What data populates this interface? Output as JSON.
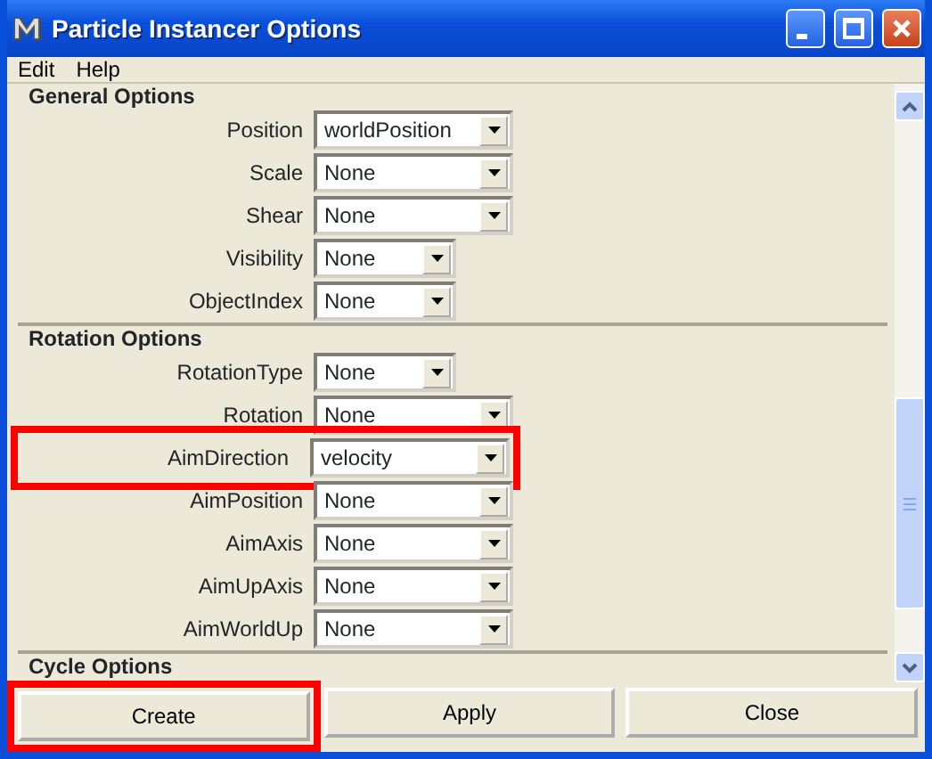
{
  "window": {
    "title": "Particle Instancer Options"
  },
  "menu": [
    "Edit",
    "Help"
  ],
  "sections": [
    {
      "title": "General Options",
      "fields": [
        {
          "label": "Position",
          "value": "worldPosition",
          "kind": "wide",
          "highlighted": false
        },
        {
          "label": "Scale",
          "value": "None",
          "kind": "wide",
          "highlighted": false
        },
        {
          "label": "Shear",
          "value": "None",
          "kind": "wide",
          "highlighted": false
        },
        {
          "label": "Visibility",
          "value": "None",
          "kind": "narrow",
          "highlighted": false
        },
        {
          "label": "ObjectIndex",
          "value": "None",
          "kind": "narrow",
          "highlighted": false
        }
      ]
    },
    {
      "title": "Rotation Options",
      "fields": [
        {
          "label": "RotationType",
          "value": "None",
          "kind": "narrow",
          "highlighted": false
        },
        {
          "label": "Rotation",
          "value": "None",
          "kind": "wide",
          "highlighted": false
        },
        {
          "label": "AimDirection",
          "value": "velocity",
          "kind": "wide",
          "highlighted": true
        },
        {
          "label": "AimPosition",
          "value": "None",
          "kind": "wide",
          "highlighted": false
        },
        {
          "label": "AimAxis",
          "value": "None",
          "kind": "wide",
          "highlighted": false
        },
        {
          "label": "AimUpAxis",
          "value": "None",
          "kind": "wide",
          "highlighted": false
        },
        {
          "label": "AimWorldUp",
          "value": "None",
          "kind": "wide",
          "highlighted": false
        }
      ]
    },
    {
      "title": "Cycle Options"
    }
  ],
  "buttons": [
    {
      "label": "Create",
      "highlighted": true
    },
    {
      "label": "Apply",
      "highlighted": false
    },
    {
      "label": "Close",
      "highlighted": false
    }
  ]
}
